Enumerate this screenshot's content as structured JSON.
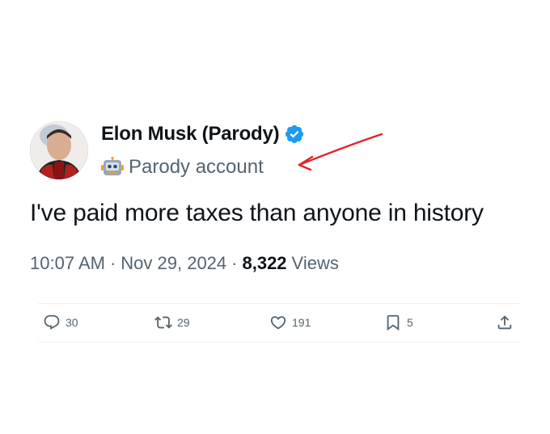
{
  "author": {
    "display_name": "Elon Musk (Parody)",
    "verified_icon": "verified-badge-icon",
    "account_type_icon": "robot-icon",
    "account_type_label": "Parody account"
  },
  "tweet": {
    "text": "I've paid more taxes than anyone in history",
    "time": "10:07 AM",
    "date": "Nov 29, 2024",
    "views_count": "8,322",
    "views_label": "Views"
  },
  "actions": {
    "reply_count": "30",
    "retweet_count": "29",
    "like_count": "191",
    "bookmark_count": "5"
  },
  "colors": {
    "text_primary": "#0f1419",
    "text_secondary": "#536471",
    "verified_blue": "#1d9bf0",
    "annotation_red": "#e0252b"
  }
}
